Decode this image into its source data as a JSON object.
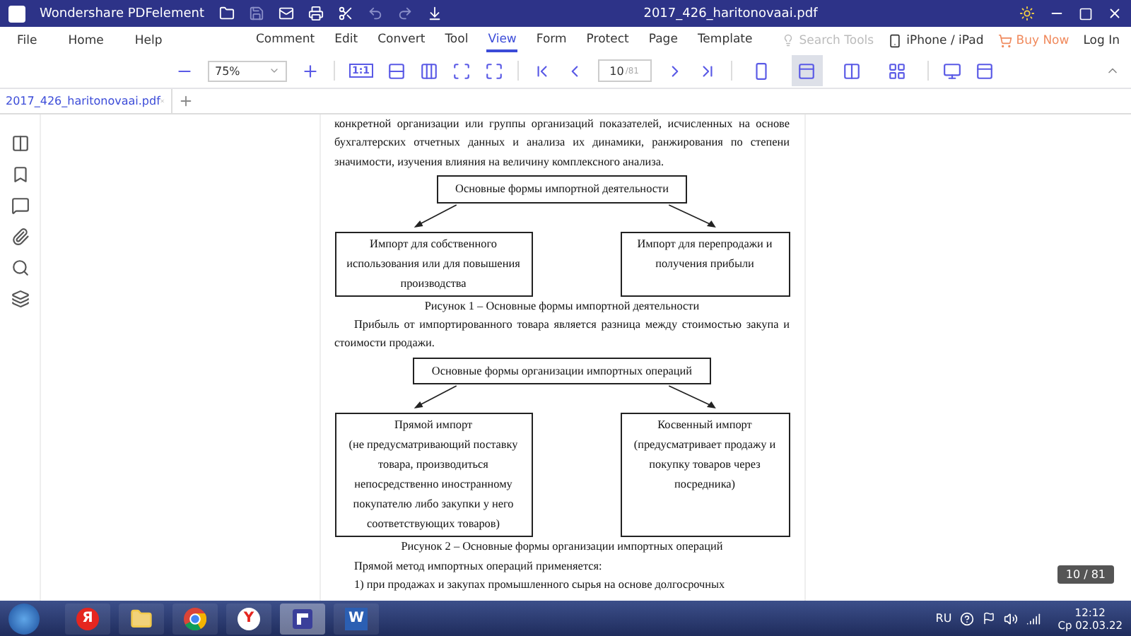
{
  "title_bar": {
    "app_name": "Wondershare PDFelement",
    "file_name": "2017_426_haritonovaai.pdf"
  },
  "menu": {
    "left": [
      "File",
      "Home",
      "Help"
    ],
    "tabs": [
      {
        "label": "Comment",
        "selected": false
      },
      {
        "label": "Edit",
        "selected": false
      },
      {
        "label": "Convert",
        "selected": false
      },
      {
        "label": "Tool",
        "selected": false
      },
      {
        "label": "View",
        "selected": true
      },
      {
        "label": "Form",
        "selected": false
      },
      {
        "label": "Protect",
        "selected": false
      },
      {
        "label": "Page",
        "selected": false
      },
      {
        "label": "Template",
        "selected": false
      }
    ],
    "search": {
      "placeholder": "Search Tools"
    },
    "device": "iPhone / iPad",
    "buy": "Buy Now",
    "login": "Log In"
  },
  "toolbar": {
    "zoom": "75%",
    "actual_size": "1:1",
    "page": "10",
    "page_total": "/81",
    "view_modes": [
      {
        "selected": false
      },
      {
        "selected": true
      },
      {
        "selected": false
      },
      {
        "selected": false
      }
    ]
  },
  "doc_tab": {
    "label": "2017_426_haritonovaai.pdf"
  },
  "document": [
    {
      "kind": "paragraph",
      "indent": false,
      "text": "конкретной организации или группы организаций показателей, исчисленных на основе бухгалтерских отчетных данных и анализа их динамики, ранжирования по степени значимости, изучения влияния на величину комплексного анализа."
    },
    {
      "kind": "diagram",
      "top": "Основные формы импортной деятельности",
      "left": [
        "Импорт для собственного",
        "использования или для повышения",
        "производства"
      ],
      "right": [
        "Импорт для перепродажи и",
        "получения прибыли"
      ]
    },
    {
      "kind": "caption",
      "text": "Рисунок 1 – Основные формы импортной деятельности"
    },
    {
      "kind": "paragraph",
      "indent": true,
      "text": "Прибыль от импортированного товара является разница между стоимостью закупа и стоимости продажи."
    },
    {
      "kind": "diagram",
      "top": "Основные формы организации импортных операций",
      "left": [
        "Прямой импорт",
        "(не предусматривающий поставку",
        "товара, производиться",
        "непосредственно иностранному",
        "покупателю либо закупки у него",
        "соответствующих товаров)"
      ],
      "right": [
        "Косвенный импорт",
        "(предусматривает продажу и",
        "покупку товаров через",
        "посредника)"
      ]
    },
    {
      "kind": "caption",
      "text": "Рисунок 2 – Основные формы организации импортных операций"
    },
    {
      "kind": "paragraph",
      "indent": true,
      "text": "Прямой метод импортных операций применяется:"
    },
    {
      "kind": "paragraph",
      "indent": true,
      "text": "1) при продажах и закупах промышленного сырья на основе долгосрочных"
    }
  ],
  "page_badge": "10 / 81",
  "taskbar": {
    "apps": [
      {
        "kind": "yandex",
        "label": "Я",
        "selected": false
      },
      {
        "kind": "folder",
        "selected": false
      },
      {
        "kind": "chrome",
        "selected": false
      },
      {
        "kind": "browser",
        "label": "Y",
        "selected": false
      },
      {
        "kind": "pdf",
        "selected": true
      },
      {
        "kind": "word",
        "label": "W",
        "selected": false
      }
    ],
    "language": "RU",
    "time": "12:12",
    "date": "Ср 02.03.22"
  }
}
